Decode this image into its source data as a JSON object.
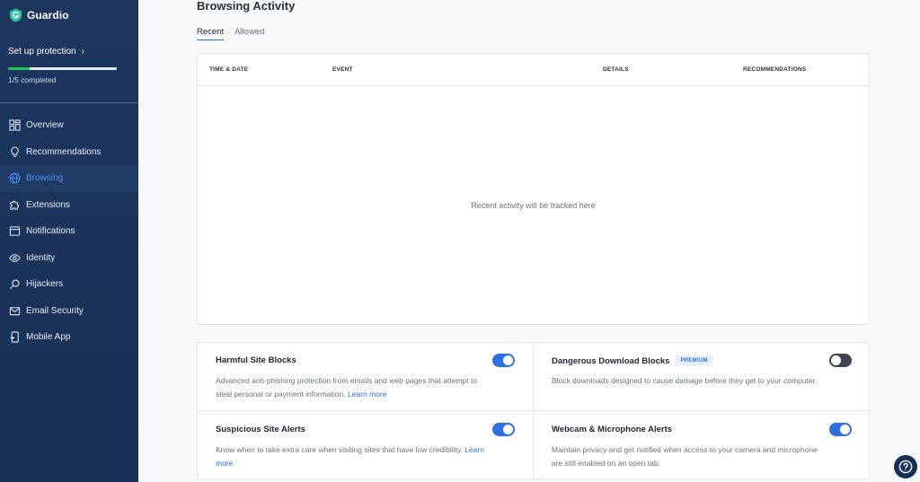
{
  "brand": {
    "name": "Guardio"
  },
  "setup": {
    "label": "Set up protection",
    "progress_fraction": 0.2,
    "progress_text": "1/5 completed"
  },
  "sidebar": {
    "items": [
      {
        "label": "Overview",
        "icon": "grid-icon"
      },
      {
        "label": "Recommendations",
        "icon": "lightbulb-icon"
      },
      {
        "label": "Browsing",
        "icon": "globe-icon",
        "active": true
      },
      {
        "label": "Extensions",
        "icon": "puzzle-icon"
      },
      {
        "label": "Notifications",
        "icon": "window-icon"
      },
      {
        "label": "Identity",
        "icon": "eye-icon"
      },
      {
        "label": "Hijackers",
        "icon": "search-icon"
      },
      {
        "label": "Email Security",
        "icon": "mail-icon"
      },
      {
        "label": "Mobile App",
        "icon": "mobile-icon"
      }
    ]
  },
  "main": {
    "title": "Browsing Activity",
    "tabs": [
      {
        "label": "Recent",
        "active": true
      },
      {
        "label": "Allowed"
      }
    ],
    "table": {
      "columns": [
        "TIME & DATE",
        "EVENT",
        "DETAILS",
        "RECOMMENDATIONS"
      ],
      "empty_text": "Recent activity will be tracked here"
    },
    "cards": [
      {
        "title": "Harmful Site Blocks",
        "desc": "Advanced anti-phishing protection from emails and web pages that attempt to steal personal or payment information.",
        "link": "Learn more",
        "enabled": true
      },
      {
        "title": "Dangerous Download Blocks",
        "badge": "PREMIUM",
        "desc": "Block downloads designed to cause damage before they get to your computer.",
        "enabled": false
      },
      {
        "title": "Suspicious Site Alerts",
        "desc": "Know when to take extra care when visiting sites that have low credibility.",
        "link": "Learn more",
        "enabled": true
      },
      {
        "title": "Webcam & Microphone Alerts",
        "desc": "Maintain privacy and get notified when access to your camera and microphone are still enabled on an open tab.",
        "enabled": true
      }
    ]
  },
  "colors": {
    "sidebar_bg": "#1c365e",
    "accent": "#2f6fe4",
    "progress": "#22c55e"
  }
}
